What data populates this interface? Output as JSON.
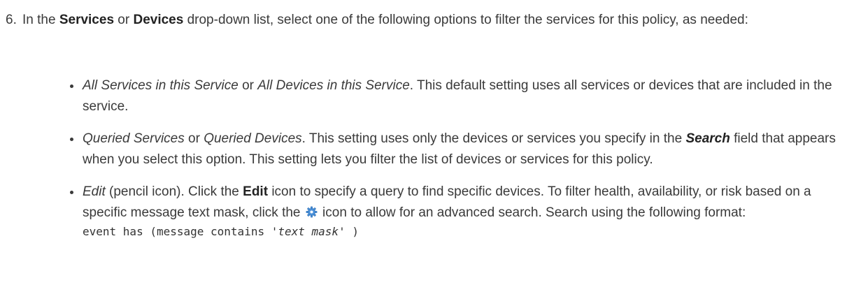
{
  "step": {
    "number": "6.",
    "intro_1": "In the ",
    "services_label": "Services",
    "intro_or": " or ",
    "devices_label": "Devices",
    "intro_2": " drop-down list, select one of the following options to filter the services for this policy, as needed:"
  },
  "bullets": [
    {
      "term_a": "All Services in this Service",
      "or": " or ",
      "term_b": "All Devices in this Service",
      "rest": ". This default setting uses all services or devices that are included in the service."
    },
    {
      "term_a": "Queried Services",
      "or": " or ",
      "term_b": "Queried Devices",
      "rest_1": ". This setting uses only the devices or services you specify in the ",
      "search_label": "Search",
      "rest_2": " field that appears when you select this option. This setting lets you filter the list of devices or services for this policy."
    },
    {
      "term": "Edit",
      "paren": " (pencil icon). Click the ",
      "edit_label": "Edit",
      "rest_1": " icon to specify a query to find specific devices. To filter health, availability, or risk based on a specific message text mask, click the ",
      "icon": "gear-icon",
      "rest_2": " icon to allow for an advanced search. Search using the following format:",
      "code_prefix": "event has (message contains '",
      "code_mask": "text mask",
      "code_suffix": "' )"
    }
  ],
  "colors": {
    "text": "#3a3a3a",
    "gear": "#4a90d9"
  }
}
